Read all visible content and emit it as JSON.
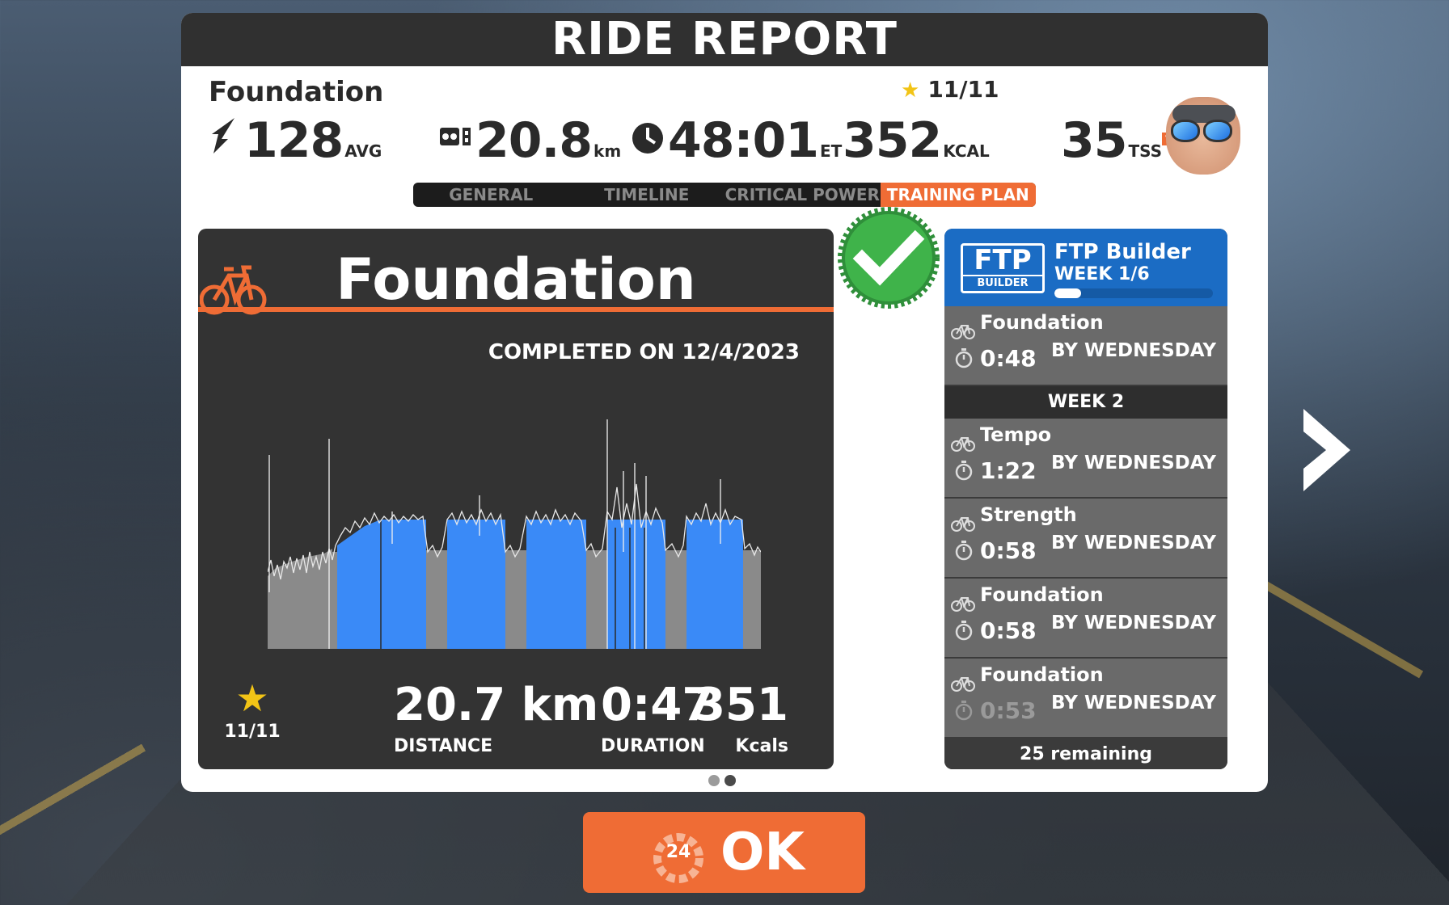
{
  "header": {
    "title": "RIDE REPORT"
  },
  "summary": {
    "workout_name": "Foundation",
    "stars": "11/11",
    "power_value": "128",
    "power_unit": "AVG",
    "distance_value": "20.8",
    "distance_unit": "km",
    "elapsed_value": "48:01",
    "elapsed_unit": "ET",
    "calories_value": "352",
    "calories_unit": "KCAL",
    "tss_value": "35",
    "tss_unit": "TSS",
    "tss_help": "?"
  },
  "tabs": [
    {
      "label": "GENERAL",
      "active": false
    },
    {
      "label": "TIMELINE",
      "active": false
    },
    {
      "label": "CRITICAL POWER",
      "active": false
    },
    {
      "label": "TRAINING PLAN",
      "active": true
    }
  ],
  "workout_card": {
    "title": "Foundation",
    "completed": "COMPLETED ON 12/4/2023",
    "stars": "11/11",
    "distance_value": "20.7 km",
    "distance_label": "DISTANCE",
    "duration_value": "0:47",
    "duration_label": "DURATION",
    "kcal_value": "351",
    "kcal_label": "Kcals"
  },
  "plan": {
    "logo_top": "FTP",
    "logo_bottom": "BUILDER",
    "name": "FTP Builder",
    "week": "WEEK 1/6",
    "progress": 0.17,
    "items_week1": [
      {
        "name": "Foundation",
        "duration": "0:48",
        "due": "BY WEDNESDAY"
      }
    ],
    "week2_label": "WEEK 2",
    "items_week2": [
      {
        "name": "Tempo",
        "duration": "1:22",
        "due": "BY WEDNESDAY"
      },
      {
        "name": "Strength",
        "duration": "0:58",
        "due": "BY WEDNESDAY"
      },
      {
        "name": "Foundation",
        "duration": "0:58",
        "due": "BY WEDNESDAY"
      },
      {
        "name": "Foundation",
        "duration": "0:53",
        "due": "BY WEDNESDAY"
      }
    ],
    "remaining": "25 remaining"
  },
  "ok_button": {
    "label": "OK",
    "countdown": "24"
  },
  "icons": [
    "power-icon",
    "distance-icon",
    "clock-icon",
    "star-icon",
    "bike-icon",
    "checkmark-badge-icon",
    "stopwatch-icon",
    "chevron-right-icon",
    "avatar"
  ],
  "colors": {
    "accent": "#ef6c35",
    "blue": "#3a8af7",
    "plan_blue": "#1b6cc4",
    "dark": "#333333"
  }
}
